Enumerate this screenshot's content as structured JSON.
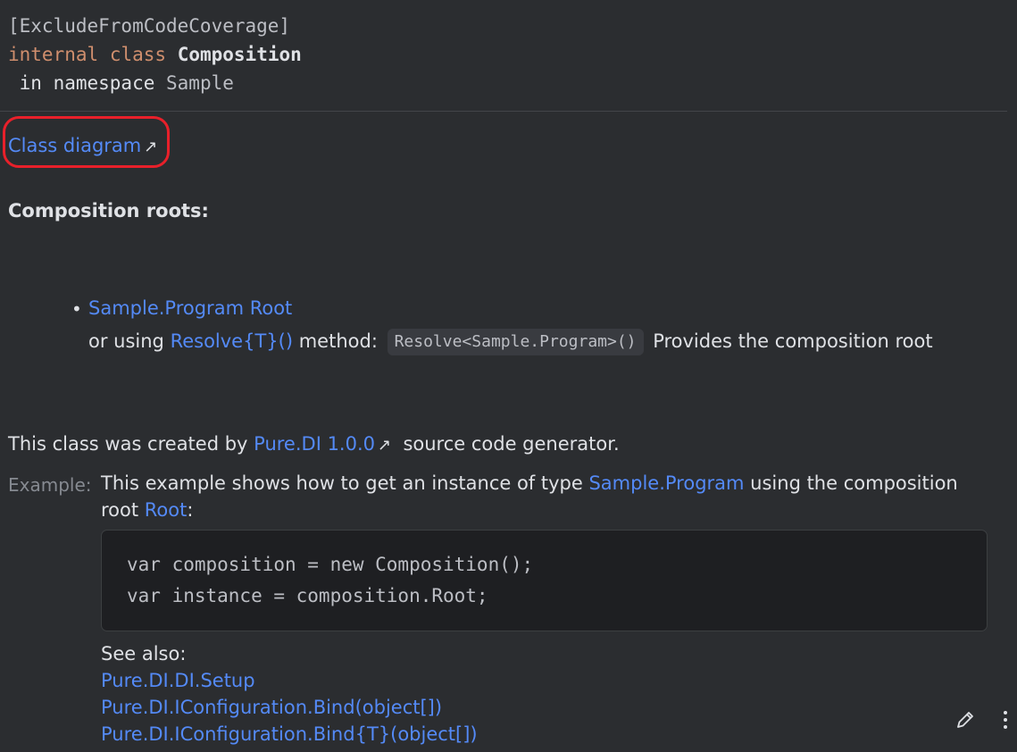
{
  "signature": {
    "attribute": "[ExcludeFromCodeCoverage]",
    "modifier": "internal",
    "keyword": "class",
    "class_name": "Composition",
    "in_word": " in namespace ",
    "namespace": "Sample"
  },
  "class_diagram": {
    "label": "Class diagram",
    "arrow": "↗"
  },
  "roots": {
    "title": "Composition roots:",
    "bullet": "•",
    "item_link": "Sample.Program Root",
    "prefix": "or using ",
    "resolve_link": "Resolve{T}()",
    "method_word": " method: ",
    "code": "Resolve<Sample.Program>()",
    "suffix": " Provides the composition root"
  },
  "created": {
    "prefix": "This class was created by ",
    "link": "Pure.DI 1.0.0",
    "arrow": "↗",
    "suffix": "  source code generator."
  },
  "example": {
    "label": "Example:",
    "text_1": "This example shows how to get an instance of type ",
    "type_link": "Sample.Program",
    "text_2": " using the composition root ",
    "root_link": "Root",
    "text_3": ":",
    "code_lines": [
      "var composition = new Composition();",
      "var instance = composition.Root;"
    ]
  },
  "see_also": {
    "label": "See also:",
    "links": [
      "Pure.DI.DI.Setup",
      "Pure.DI.IConfiguration.Bind(object[])",
      "Pure.DI.IConfiguration.Bind{T}(object[])"
    ]
  },
  "colors": {
    "background": "#2b2d30",
    "link": "#548af7",
    "keyword": "#cf8e6d",
    "highlight": "#e8202a"
  },
  "icons": [
    "edit-icon",
    "more-options-icon"
  ]
}
